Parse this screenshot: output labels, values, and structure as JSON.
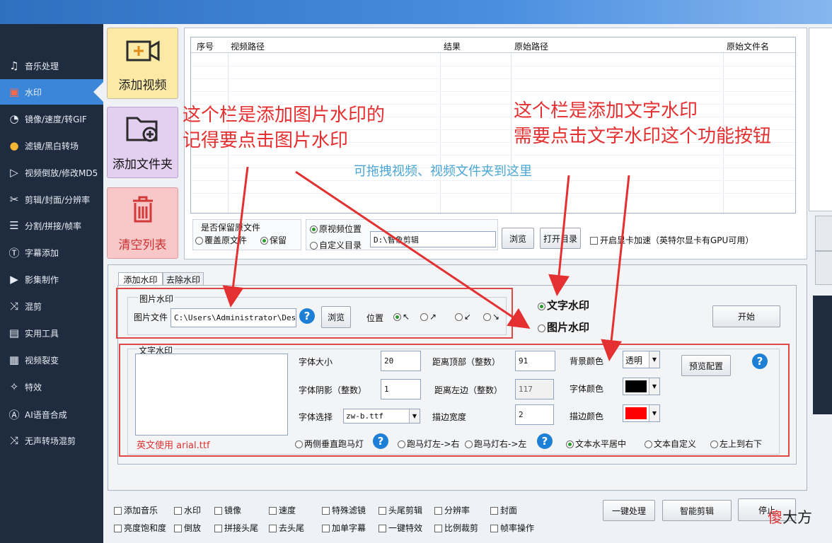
{
  "sidebar": {
    "items": [
      {
        "label": "音乐处理",
        "icon": "music-note-icon"
      },
      {
        "label": "水印",
        "icon": "watermark-icon"
      },
      {
        "label": "镜像/速度/转GIF",
        "icon": "speedometer-icon"
      },
      {
        "label": "滤镜/黑白转场",
        "icon": "filter-circles-icon"
      },
      {
        "label": "视频倒放/修改MD5",
        "icon": "reverse-play-icon"
      },
      {
        "label": "剪辑/封面/分辨率",
        "icon": "scissors-icon"
      },
      {
        "label": "分割/拼接/帧率",
        "icon": "split-icon"
      },
      {
        "label": "字幕添加",
        "icon": "subtitle-icon"
      },
      {
        "label": "影集制作",
        "icon": "album-play-icon"
      },
      {
        "label": "混剪",
        "icon": "shuffle-icon"
      },
      {
        "label": "实用工具",
        "icon": "toolbox-icon"
      },
      {
        "label": "视频裂变",
        "icon": "film-fission-icon"
      },
      {
        "label": "特效",
        "icon": "sparkle-icon"
      },
      {
        "label": "AI语音合成",
        "icon": "ai-voice-icon"
      },
      {
        "label": "无声转场混剪",
        "icon": "silent-shuffle-icon"
      }
    ],
    "active_index": 1
  },
  "actions": {
    "add_video": "添加视频",
    "add_folder": "添加文件夹",
    "clear_list": "清空列表"
  },
  "table": {
    "columns": [
      "序号",
      "视频路径",
      "结果",
      "原始路径",
      "原始文件名"
    ],
    "drop_hint": "可拖拽视频、视频文件夹到这里"
  },
  "output": {
    "keep_original_title": "是否保留原文件",
    "overwrite_label": "覆盖原文件",
    "keep_label": "保留",
    "keep_selected": "保留",
    "orig_location_label": "原视频位置",
    "custom_dir_label": "自定义目录",
    "location_selected": "原视频位置",
    "path_value": "D:\\智象剪辑",
    "browse": "浏览",
    "open_dir": "打开目录",
    "gpu_label": "开启显卡加速（英特尔显卡有GPU可用）"
  },
  "watermark": {
    "tabs": [
      "添加水印",
      "去除水印"
    ],
    "active_tab": "添加水印",
    "image": {
      "group_title": "图片水印",
      "file_label": "图片文件",
      "file_value": "C:\\Users\\Administrator\\Desktop",
      "browse": "浏览",
      "position_label": "位置",
      "positions": [
        "↖",
        "↗",
        "↙",
        "↘"
      ],
      "position_selected": "↖"
    },
    "mode_text": "文字水印",
    "mode_image": "图片水印",
    "mode_selected": "文字水印",
    "start": "开始",
    "text": {
      "group_title": "文字水印",
      "hint": "英文使用 arial.ttf",
      "font_size_label": "字体大小",
      "font_size": "20",
      "shadow_label": "字体阴影（整数）",
      "shadow": "1",
      "font_label": "字体选择",
      "font": "zw-b.ttf",
      "top_label": "距离顶部（整数）",
      "top": "91",
      "left_label": "距离左边（整数）",
      "left": "117",
      "stroke_width_label": "描边宽度",
      "stroke_width": "2",
      "bg_color_label": "背景颜色",
      "bg_color": "透明",
      "font_color_label": "字体颜色",
      "font_color": "#000000",
      "stroke_color_label": "描边颜色",
      "stroke_color": "#ff0000",
      "preview": "预览配置",
      "effects": [
        "两侧垂直跑马灯",
        "跑马灯左->右",
        "跑马灯右->左",
        "文本水平居中",
        "文本自定义",
        "左上到右下"
      ],
      "effect_selected": "文本水平居中"
    }
  },
  "annotations": {
    "image_note_1": "这个栏是添加图片水印的",
    "image_note_2": "记得要点击图片水印",
    "text_note_1": "这个栏是添加文字水印",
    "text_note_2": "需要点击文字水印这个功能按钮"
  },
  "bottom": {
    "checks_row1": [
      "添加音乐",
      "水印",
      "镜像",
      "速度",
      "特殊滤镜",
      "头尾剪辑",
      "分辨率",
      "封面"
    ],
    "checks_row2": [
      "亮度饱和度",
      "倒放",
      "拼接头尾",
      "去头尾",
      "加单字幕",
      "一键特效",
      "比例裁剪",
      "帧率操作"
    ],
    "one_click": "一键处理",
    "smart_edit": "智能剪辑",
    "stop": "停止"
  },
  "logo": "傻大方",
  "colors": {
    "sidebar_bg": "#1f2b3e",
    "active_item": "#3b86d8",
    "annotation": "#e43030",
    "drop_hint": "#4aa6d4"
  }
}
